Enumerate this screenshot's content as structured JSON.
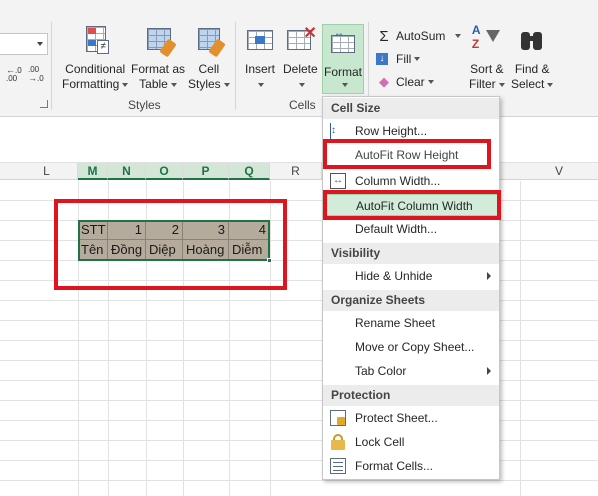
{
  "ribbon": {
    "styles_group": {
      "conditional_formatting": [
        "Conditional",
        "Formatting"
      ],
      "format_as_table": [
        "Format as",
        "Table"
      ],
      "cell_styles": [
        "Cell",
        "Styles"
      ],
      "label": "Styles"
    },
    "cells_group": {
      "insert": "Insert",
      "delete": "Delete",
      "format": "Format",
      "label": "Cells"
    },
    "editing_group": {
      "autosum": "AutoSum",
      "fill": "Fill",
      "clear": "Clear",
      "sort_filter": [
        "Sort &",
        "Filter"
      ],
      "find_select": [
        "Find &",
        "Select"
      ]
    },
    "number_group": {
      "increase_decimal": ".0\n.00",
      "decrease_decimal": ".00\n.0"
    }
  },
  "sheet": {
    "column_headers": [
      "L",
      "M",
      "N",
      "O",
      "P",
      "Q",
      "R",
      "V"
    ],
    "row1": [
      "STT",
      "1",
      "2",
      "3",
      "4"
    ],
    "row2": [
      "Tên",
      "Đồng",
      "Diệp",
      "Hoàng",
      "Diễm"
    ]
  },
  "menu": {
    "sections": {
      "cell_size": "Cell Size",
      "visibility": "Visibility",
      "organize_sheets": "Organize Sheets",
      "protection": "Protection"
    },
    "items": {
      "row_height": "Row Height...",
      "autofit_row_height": "AutoFit Row Height",
      "column_width": "Column Width...",
      "autofit_column_width": "AutoFit Column Width",
      "default_width": "Default Width...",
      "hide_unhide": "Hide & Unhide",
      "rename_sheet": "Rename Sheet",
      "move_copy_sheet": "Move or Copy Sheet...",
      "tab_color": "Tab Color",
      "protect_sheet": "Protect Sheet...",
      "lock_cell": "Lock Cell",
      "format_cells": "Format Cells..."
    }
  },
  "colors": {
    "accent_green": "#217346",
    "highlight_red": "#e0141e",
    "cell_fill": "#b5ab9c"
  }
}
